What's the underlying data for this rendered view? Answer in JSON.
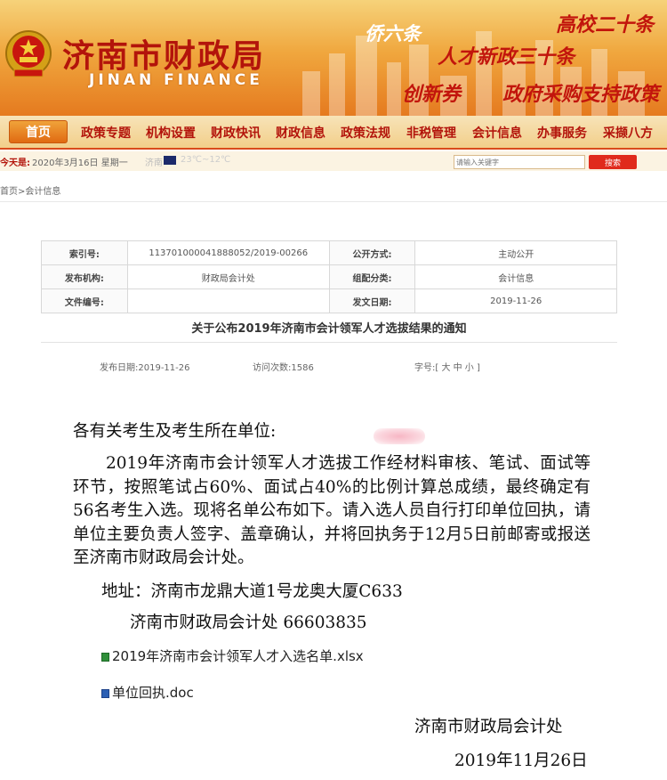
{
  "header": {
    "site_name": "济南市财政局",
    "site_name_en": "JINAN FINANCE",
    "slogans": [
      "侨六条",
      "高校二十条",
      "人才新政三十条",
      "创新券",
      "政府采购支持政策"
    ]
  },
  "nav": {
    "items": [
      "首页",
      "政策专题",
      "机构设置",
      "财政快讯",
      "财政信息",
      "政策法规",
      "非税管理",
      "会计信息",
      "办事服务",
      "采撷八方"
    ]
  },
  "infobar": {
    "today_label": "今天是:",
    "date": "2020年3月16日 星期一",
    "weather_city": "济南",
    "weather_temp": "23℃~12℃",
    "search_placeholder": "请输入关键字",
    "search_button": "搜索"
  },
  "breadcrumb": "首页>会计信息",
  "meta": {
    "index_label": "索引号:",
    "index_value": "113701000041888052/2019-00266",
    "public_label": "公开方式:",
    "public_value": "主动公开",
    "org_label": "发布机构:",
    "org_value": "财政局会计处",
    "category_label": "组配分类:",
    "category_value": "会计信息",
    "fileno_label": "文件编号:",
    "fileno_value": "",
    "issue_date_label": "发文日期:",
    "issue_date_value": "2019-11-26"
  },
  "document": {
    "title": "关于公布2019年济南市会计领军人才选拔结果的通知",
    "publish_date": "发布日期:2019-11-26",
    "visits": "访问次数:1586",
    "font_size": "字号:[ 大 中 小 ]",
    "salutation": "各有关考生及考生所在单位:",
    "paragraph": "2019年济南市会计领军人才选拔工作经材料审核、笔试、面试等环节，按照笔试占60%、面试占40%的比例计算总成绩，最终确定有56名考生入选。现将名单公布如下。请入选人员自行打印单位回执，请单位主要负责人签字、盖章确认，并将回执务于12月5日前邮寄或报送至济南市财政局会计处。",
    "address": "地址：济南市龙鼎大道1号龙奥大厦C633",
    "contact": "济南市财政局会计处 66603835",
    "attachments": [
      "2019年济南市会计领军人才入选名单.xlsx",
      "单位回执.doc"
    ],
    "signature": "济南市财政局会计处",
    "sign_date": "2019年11月26日"
  }
}
